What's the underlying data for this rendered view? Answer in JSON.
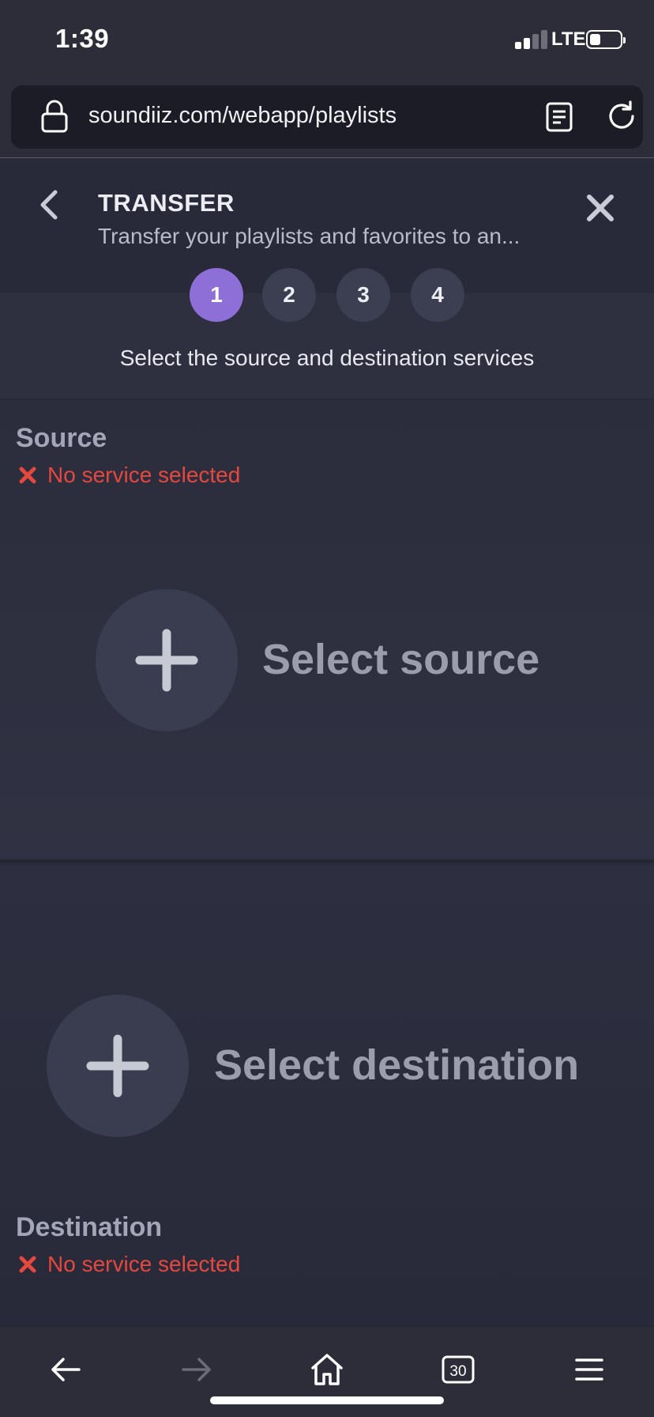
{
  "status_bar": {
    "time": "1:39",
    "network": "LTE"
  },
  "browser": {
    "url": "soundiiz.com/webapp/playlists",
    "tab_count": "30"
  },
  "header": {
    "title": "TRANSFER",
    "subtitle": "Transfer your playlists and favorites to an..."
  },
  "steps": {
    "items": [
      "1",
      "2",
      "3",
      "4"
    ],
    "active_index": 0,
    "caption": "Select the source and destination services"
  },
  "source": {
    "label": "Source",
    "status": "No service selected",
    "action_label": "Select source"
  },
  "destination": {
    "label": "Destination",
    "status": "No service selected",
    "action_label": "Select destination"
  },
  "colors": {
    "accent": "#8e6fd8",
    "error": "#e5483f",
    "background": "#2b2d3d"
  },
  "icons": {
    "lock": "lock-icon",
    "reader": "reader-icon",
    "reload": "reload-icon",
    "back": "chevron-left-icon",
    "close": "close-icon",
    "plus": "plus-icon",
    "error": "x-mark-icon",
    "nav_back": "arrow-left-icon",
    "nav_forward": "arrow-right-icon",
    "home": "home-icon",
    "tabs": "tabs-icon",
    "menu": "menu-icon"
  }
}
